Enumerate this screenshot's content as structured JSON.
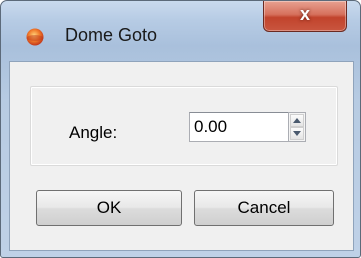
{
  "window": {
    "title": "Dome Goto",
    "close_glyph": "x",
    "icon": "app-sun-icon"
  },
  "form": {
    "angle_label": "Angle:",
    "angle_value": "0.00"
  },
  "buttons": {
    "ok_label": "OK",
    "cancel_label": "Cancel"
  },
  "colors": {
    "close_button": "#c9563f",
    "frame": "#b6cbe4"
  }
}
